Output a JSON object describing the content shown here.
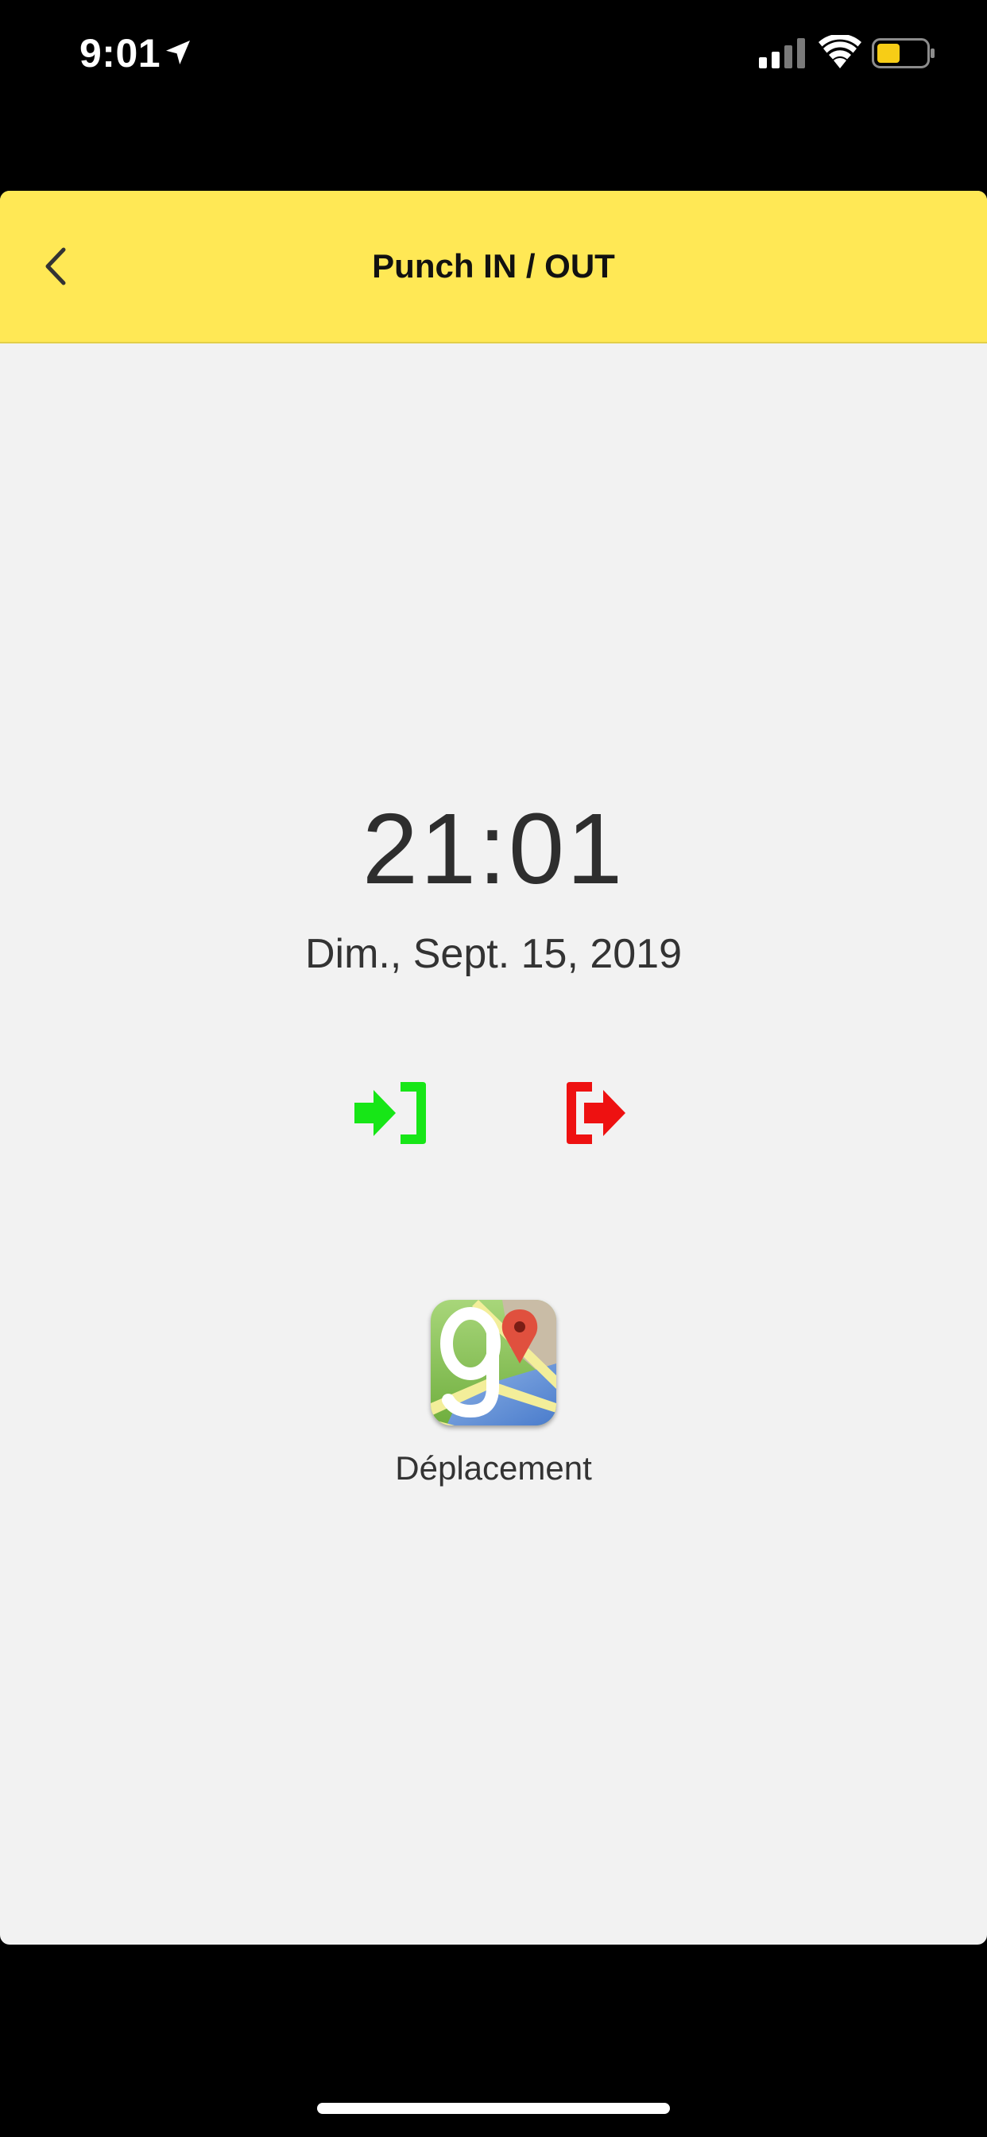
{
  "status_bar": {
    "time": "9:01",
    "icons": [
      "location-arrow-icon",
      "cell-signal-icon",
      "wifi-icon",
      "battery-icon"
    ],
    "battery_color": "#f7cd16"
  },
  "nav": {
    "title": "Punch IN / OUT",
    "back_icon": "chevron-left-icon",
    "background_color": "#ffe855"
  },
  "clock": {
    "time": "21:01",
    "date": "Dim., Sept. 15, 2019"
  },
  "actions": {
    "punch_in_icon": "sign-in-icon",
    "punch_in_color": "#17e617",
    "punch_out_icon": "sign-out-icon",
    "punch_out_color": "#ee1111"
  },
  "deplacement": {
    "icon": "google-maps-icon",
    "label": "Déplacement"
  }
}
